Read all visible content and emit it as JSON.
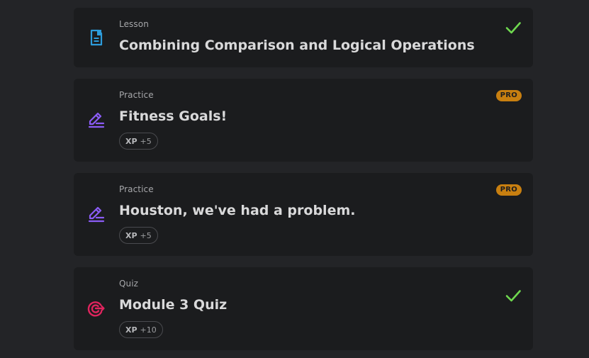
{
  "items": [
    {
      "type": "Lesson",
      "title": "Combining Comparison and Logical Operations",
      "icon": "lesson-document-icon",
      "completed": true
    },
    {
      "type": "Practice",
      "title": "Fitness Goals!",
      "icon": "practice-pencil-icon",
      "badge": "PRO",
      "xp_label": "XP",
      "xp_value": "+5"
    },
    {
      "type": "Practice",
      "title": "Houston, we've had a problem.",
      "icon": "practice-pencil-icon",
      "badge": "PRO",
      "xp_label": "XP",
      "xp_value": "+5"
    },
    {
      "type": "Quiz",
      "title": "Module 3 Quiz",
      "icon": "quiz-target-icon",
      "completed": true,
      "xp_label": "XP",
      "xp_value": "+10"
    }
  ],
  "colors": {
    "background": "#232427",
    "card": "#1b1c1e",
    "lesson_icon": "#2d9cdb",
    "practice_icon": "#8b5cf6",
    "quiz_icon": "#e0245e",
    "check": "#6fd94f",
    "pro_badge": "#c87f10"
  }
}
